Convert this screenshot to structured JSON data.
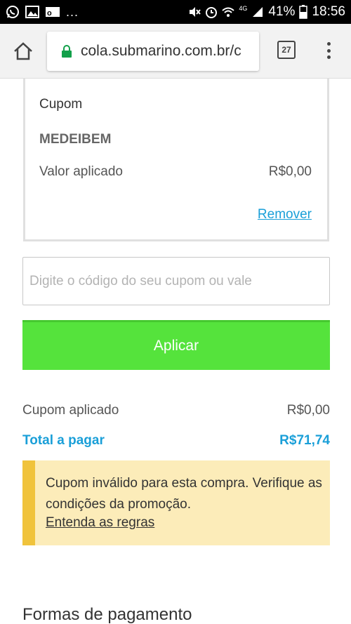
{
  "status_bar": {
    "notification_dots": "...",
    "network": "4G",
    "battery": "41%",
    "time": "18:56"
  },
  "browser": {
    "url": "cola.submarino.com.br/c",
    "tab_count": "27"
  },
  "coupon_card": {
    "title": "Cupom",
    "code": "MEDEIBEM",
    "applied_label": "Valor aplicado",
    "applied_value": "R$0,00",
    "remove_label": "Remover"
  },
  "coupon_input": {
    "placeholder": "Digite o código do seu cupom ou vale",
    "value": ""
  },
  "apply_button": {
    "label": "Aplicar"
  },
  "summary": {
    "coupon_label": "Cupom aplicado",
    "coupon_value": "R$0,00",
    "total_label": "Total a pagar",
    "total_value": "R$71,74"
  },
  "alert": {
    "message": "Cupom inválido para esta compra. Verifique as condições da promoção.",
    "link_label": "Entenda as regras"
  },
  "payment_section": {
    "title": "Formas de pagamento"
  },
  "colors": {
    "accent_blue": "#1a9fd8",
    "apply_green": "#55e33c",
    "alert_bg": "#fcecb9",
    "alert_bar": "#f0c33c"
  }
}
